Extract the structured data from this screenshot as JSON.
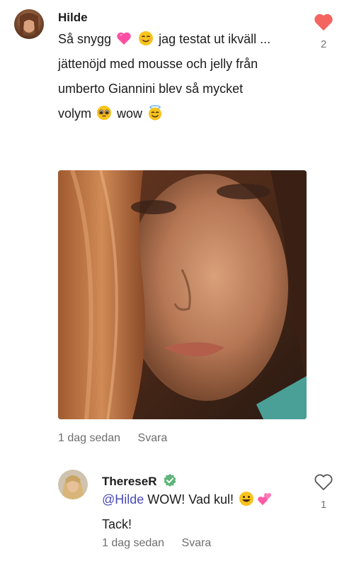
{
  "comments": [
    {
      "author": "Hilde",
      "lines": [
        {
          "parts": [
            {
              "t": "Så snygg "
            },
            {
              "e": "heart"
            },
            {
              "t": " "
            },
            {
              "e": "smile"
            },
            {
              "t": " jag testat ut ikväll ..."
            }
          ]
        },
        {
          "parts": [
            {
              "t": "jättenöjd med mousse och jelly från"
            }
          ]
        },
        {
          "parts": [
            {
              "t": "umberto Giannini blev så mycket"
            }
          ]
        },
        {
          "parts": [
            {
              "t": "volym "
            },
            {
              "e": "pleading"
            },
            {
              "t": " wow "
            },
            {
              "e": "halo"
            }
          ]
        }
      ],
      "likes": "2",
      "liked": true,
      "time": "1 dag sedan",
      "reply": "Svara"
    },
    {
      "author": "ThereseR",
      "verified": true,
      "mention": "@Hilde",
      "line1_rest": " WOW! Vad kul! ",
      "line2": "Tack!",
      "likes": "1",
      "liked": false,
      "time": "1 dag sedan",
      "reply": "Svara"
    }
  ],
  "colors": {
    "liked_heart": "#f4655f",
    "verified": "#5fb57a",
    "mention": "#4a4ab8"
  },
  "icons": {
    "like": "heart-icon",
    "verified": "verified-badge-icon"
  }
}
